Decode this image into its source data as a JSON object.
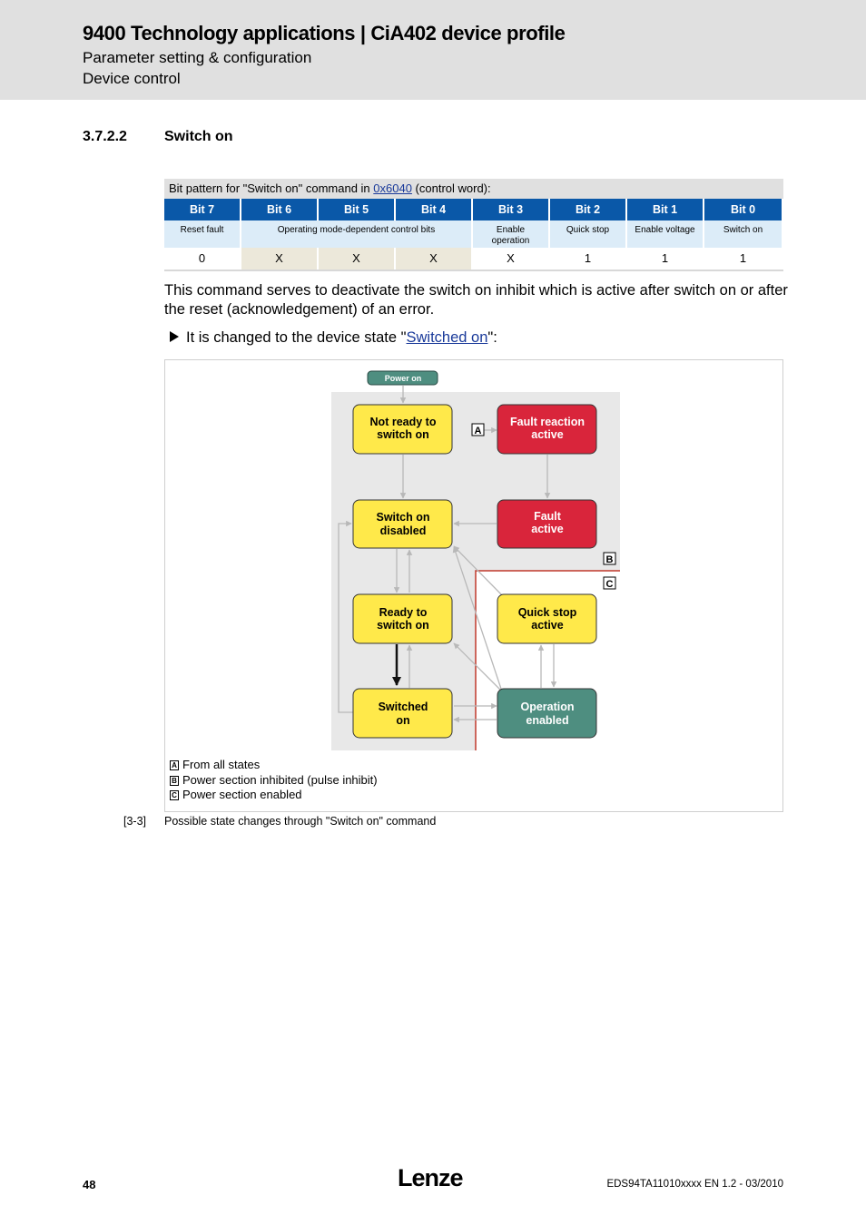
{
  "header": {
    "title": "9400 Technology applications | CiA402 device profile",
    "subtitle1": "Parameter setting & configuration",
    "subtitle2": "Device control"
  },
  "section": {
    "number": "3.7.2.2",
    "title": "Switch on"
  },
  "bit_table": {
    "caption_before": "Bit pattern for \"Switch on\" command in ",
    "caption_link": "0x6040",
    "caption_after": " (control word):",
    "headers": [
      "Bit 7",
      "Bit 6",
      "Bit 5",
      "Bit 4",
      "Bit 3",
      "Bit 2",
      "Bit 1",
      "Bit 0"
    ],
    "descriptions": [
      "Reset fault",
      "Operating mode-dependent control bits",
      "Enable operation",
      "Quick stop",
      "Enable voltage",
      "Switch on"
    ],
    "values": [
      "0",
      "X",
      "X",
      "X",
      "X",
      "1",
      "1",
      "1"
    ]
  },
  "body": {
    "paragraph": "This command serves to deactivate the switch on inhibit which is active after switch on or after the reset (acknowledgement) of an error.",
    "bullet_before": "It is changed to the device state \"",
    "bullet_link": "Switched on",
    "bullet_after": "\":"
  },
  "diagram": {
    "power_on": "Power on",
    "states": {
      "not_ready": [
        "Not ready to",
        "switch on"
      ],
      "fault_reaction": [
        "Fault reaction",
        "active"
      ],
      "switch_on_disabled": [
        "Switch on",
        "disabled"
      ],
      "fault": [
        "Fault",
        "active"
      ],
      "ready": [
        "Ready to",
        "switch on"
      ],
      "quick_stop": [
        "Quick stop",
        "active"
      ],
      "switched_on": [
        "Switched",
        "on"
      ],
      "operation_enabled": [
        "Operation",
        "enabled"
      ]
    },
    "markers": {
      "a": "A",
      "b": "B",
      "c": "C"
    },
    "colors": {
      "yellow": "#ffe94a",
      "red": "#d9253b",
      "green": "#4e8e80",
      "gray_area": "#e8e8e8",
      "power_section_line": "#c0392b"
    }
  },
  "legend": [
    {
      "key": "A",
      "text": "From all states"
    },
    {
      "key": "B",
      "text": "Power section inhibited (pulse inhibit)"
    },
    {
      "key": "C",
      "text": "Power section enabled"
    }
  ],
  "figure": {
    "number": "[3-3]",
    "caption": "Possible state changes through \"Switch on\" command"
  },
  "footer": {
    "page": "48",
    "logo": "Lenze",
    "doc_id": "EDS94TA11010xxxx EN 1.2 - 03/2010"
  }
}
